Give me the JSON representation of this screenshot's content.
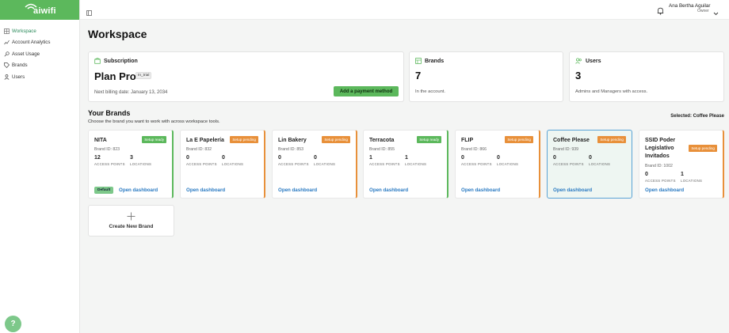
{
  "app": {
    "logo_text": "aiwifi"
  },
  "sidebar": {
    "items": [
      {
        "label": "Workspace",
        "icon": "grid-icon",
        "active": true
      },
      {
        "label": "Account Analytics",
        "icon": "chart-icon",
        "active": false
      },
      {
        "label": "Asset Usage",
        "icon": "key-icon",
        "active": false
      },
      {
        "label": "Brands",
        "icon": "tag-icon",
        "active": false
      },
      {
        "label": "Users",
        "icon": "user-icon",
        "active": false
      }
    ]
  },
  "topbar": {
    "user_name": "Ana Bertha Aguilar",
    "user_role": "Owner"
  },
  "page": {
    "title": "Workspace"
  },
  "subscription": {
    "heading": "Subscription",
    "plan": "Plan Pro",
    "badge": "In_trial",
    "billing": "Next billing date: January 13, 2034",
    "button": "Add a payment method"
  },
  "brands_summary": {
    "heading": "Brands",
    "count": "7",
    "sub": "In the account."
  },
  "users_summary": {
    "heading": "Users",
    "count": "3",
    "sub": "Admins and Managers with access."
  },
  "your_brands": {
    "title": "Your Brands",
    "subtitle": "Choose the brand you want to work with across workspace tools.",
    "selected": "Selected: Coffee Please",
    "open_label": "Open dashboard",
    "access_label": "ACCESS POINTS",
    "locations_label": "LOCATIONS",
    "default_label": "Default",
    "create_label": "Create New Brand",
    "brands": [
      {
        "name": "NITA",
        "status": "Setup ready",
        "id": "Brand ID: 823",
        "access": "12",
        "locations": "3"
      },
      {
        "name": "La E Papelería",
        "status": "Setup pending",
        "id": "Brand ID: 832",
        "access": "0",
        "locations": "0"
      },
      {
        "name": "Lin Bakery",
        "status": "Setup pending",
        "id": "Brand ID: 853",
        "access": "0",
        "locations": "0"
      },
      {
        "name": "Terracota",
        "status": "Setup ready",
        "id": "Brand ID: 855",
        "access": "1",
        "locations": "1"
      },
      {
        "name": "FLIP",
        "status": "Setup pending",
        "id": "Brand ID: 866",
        "access": "0",
        "locations": "0"
      },
      {
        "name": "Coffee Please",
        "status": "Setup pending",
        "id": "Brand ID: 939",
        "access": "0",
        "locations": "0"
      },
      {
        "name": "SSID Poder Legislativo Invitados",
        "status": "Setup pending",
        "id": "Brand ID: 1002",
        "access": "0",
        "locations": "1"
      }
    ]
  },
  "colors": {
    "brand_green": "#5cb85c",
    "pending_orange": "#e8903a",
    "link_blue": "#2a7ac2",
    "selected_border": "#5aa3d6"
  }
}
